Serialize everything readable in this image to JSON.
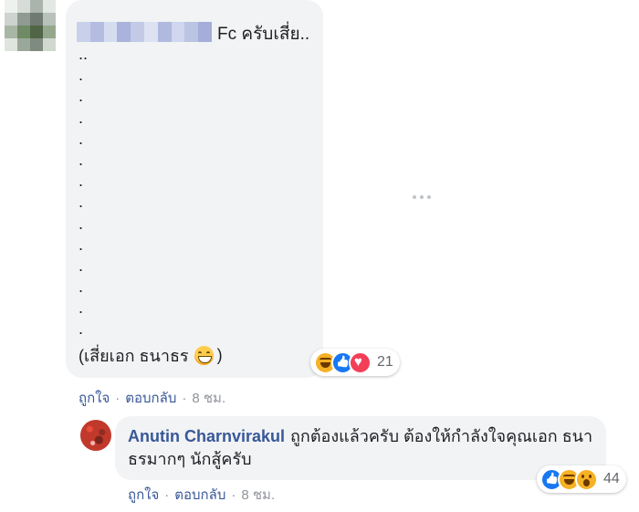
{
  "comment": {
    "text": "Fc ครับเสี่ย..",
    "dot_lines": [
      "..",
      ".",
      ".",
      ".",
      ".",
      ".",
      ".",
      ".",
      ".",
      ".",
      ".",
      ".",
      ".",
      ".",
      "."
    ],
    "signature_open": "(เสี่ยเอก ธนาธร",
    "signature_close": ")",
    "emoji": "grinning-face-with-smiling-eyes",
    "reactions": {
      "icons": [
        "haha-icon",
        "like-icon",
        "love-icon"
      ],
      "count": "21"
    },
    "actions": {
      "like": "ถูกใจ",
      "reply": "ตอบกลับ",
      "time": "8 ชม."
    }
  },
  "reply": {
    "author": "Anutin Charnvirakul",
    "text": "ถูกต้องแล้วครับ ต้องให้กำลังใจคุณเอก ธนาธรมากๆ นักสู้ครับ",
    "reactions": {
      "icons": [
        "like-icon",
        "haha-icon",
        "wow-icon"
      ],
      "count": "44"
    },
    "actions": {
      "like": "ถูกใจ",
      "reply": "ตอบกลับ",
      "time": "8 ชม."
    }
  },
  "colors": {
    "bubble": "#f2f3f5",
    "link": "#385898",
    "meta": "#90949c",
    "like": "#1877f2",
    "love": "#f33e58",
    "haha": "#f7b125"
  }
}
